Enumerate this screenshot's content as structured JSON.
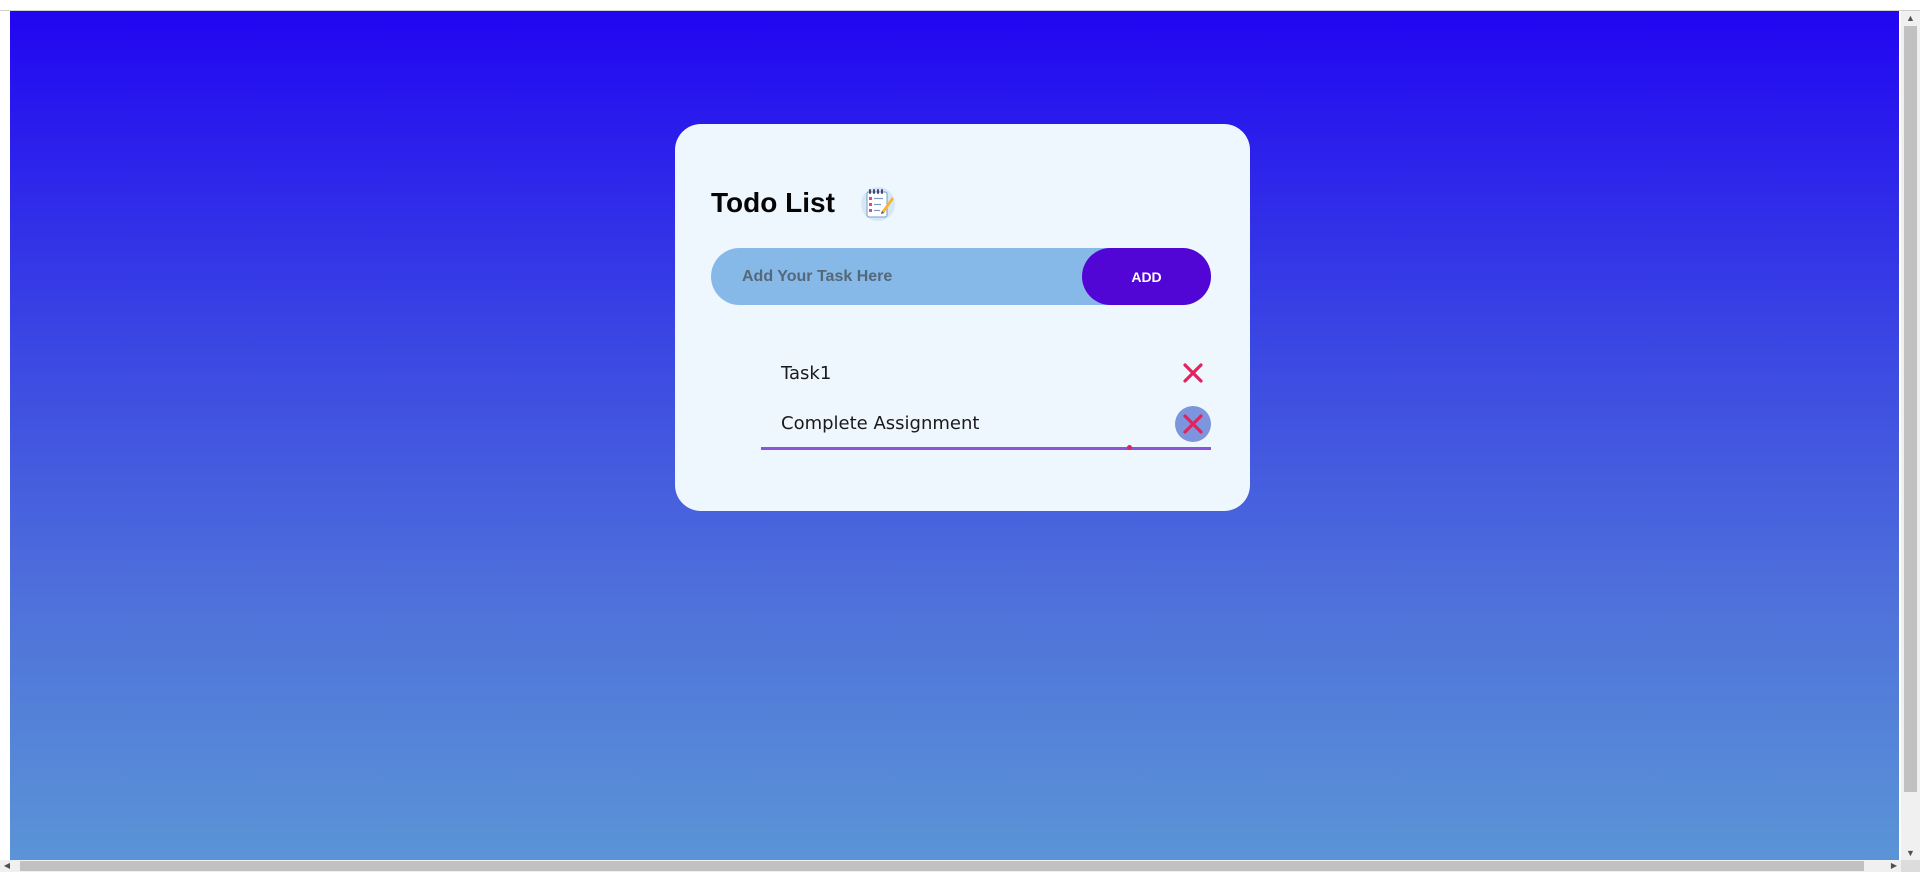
{
  "app": {
    "title": "Todo List",
    "title_icon": "notepad-checklist-icon"
  },
  "input": {
    "placeholder": "Add Your Task Here",
    "value": ""
  },
  "add_button": {
    "label": "ADD"
  },
  "tasks": [
    {
      "text": "Task1",
      "delete_icon": "close-icon",
      "hovered": false
    },
    {
      "text": "Complete Assignment",
      "delete_icon": "close-icon",
      "hovered": true
    }
  ],
  "colors": {
    "background_top": "#2105f2",
    "background_bottom": "#5a94d6",
    "card": "#eef6fe",
    "input_bg": "#86b9e7",
    "add_button": "#5206d6",
    "delete_icon": "#e0245e",
    "active_underline": "#8a55dc"
  }
}
